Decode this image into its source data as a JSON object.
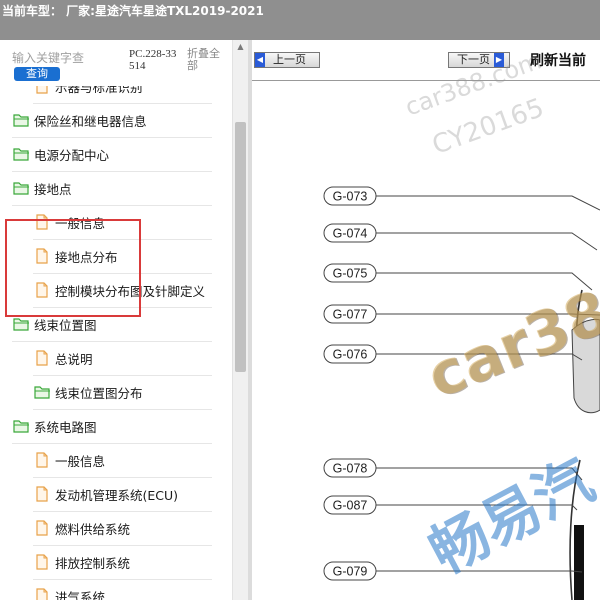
{
  "header": {
    "title": "当前车型：  厂家:星途汽车星途TXL2019-2021"
  },
  "search": {
    "placeholder": "输入关键字查",
    "button_label": "查询",
    "code": "PC.228-33514",
    "collapse_label": "折叠全部"
  },
  "tree": {
    "items": [
      {
        "label": "示器与标准识别",
        "type": "doc"
      },
      {
        "label": "保险丝和继电器信息",
        "type": "folder"
      },
      {
        "label": "电源分配中心",
        "type": "folder"
      },
      {
        "label": "接地点",
        "type": "folder"
      },
      {
        "label": "一般信息",
        "type": "doc"
      },
      {
        "label": "接地点分布",
        "type": "doc"
      },
      {
        "label": "控制模块分布图及针脚定义",
        "type": "doc"
      },
      {
        "label": "线束位置图",
        "type": "folder"
      },
      {
        "label": "总说明",
        "type": "doc"
      },
      {
        "label": "线束位置图分布",
        "type": "folder"
      },
      {
        "label": "系统电路图",
        "type": "folder"
      },
      {
        "label": "一般信息",
        "type": "doc"
      },
      {
        "label": "发动机管理系统(ECU)",
        "type": "doc"
      },
      {
        "label": "燃料供给系统",
        "type": "doc"
      },
      {
        "label": "排放控制系统",
        "type": "doc"
      },
      {
        "label": "进气系统",
        "type": "doc"
      }
    ]
  },
  "viewer": {
    "prev_label": "上一页",
    "next_label": "下一页",
    "refresh_label": "刷新当前"
  },
  "diagram": {
    "labels": [
      "G-073",
      "G-074",
      "G-075",
      "G-077",
      "G-076",
      "G-078",
      "G-087",
      "G-079"
    ]
  },
  "watermarks": {
    "site": "car388.com",
    "user": "CY20165",
    "big": "car388",
    "cn": "畅易汽"
  },
  "colors": {
    "accent": "#1a6fd1",
    "highlight": "#d93a3a",
    "folder": "#3aa83a",
    "doc": "#e8a24a",
    "topbar": "#8f8f8f"
  }
}
